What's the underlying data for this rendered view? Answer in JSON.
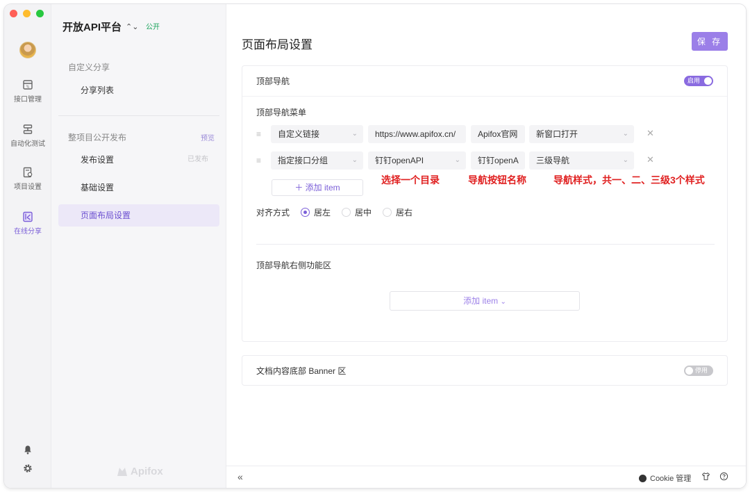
{
  "window": {
    "colors": {
      "close": "#ff5f57",
      "minimize": "#febc2e",
      "maximize": "#28c840"
    }
  },
  "rail": {
    "items": [
      {
        "label": "接口管理",
        "icon": "api-icon"
      },
      {
        "label": "自动化测试",
        "icon": "automation-icon"
      },
      {
        "label": "项目设置",
        "icon": "settings-doc-icon"
      },
      {
        "label": "在线分享",
        "icon": "share-icon",
        "active": true
      }
    ],
    "bottom_icons": [
      "bell-icon",
      "gear-icon"
    ]
  },
  "sidebar": {
    "project_name": "开放API平台",
    "project_badge": "公开",
    "section1": "自定义分享",
    "item_share_list": "分享列表",
    "section2": "整项目公开发布",
    "section2_tag": "预览",
    "item_publish": "发布设置",
    "item_publish_tag": "已发布",
    "item_basic": "基础设置",
    "item_layout": "页面布局设置",
    "brand": "Apifox"
  },
  "main": {
    "title": "页面布局设置",
    "save": "保 存",
    "top_nav": {
      "label": "顶部导航",
      "toggle": "启用",
      "menu_label": "顶部导航菜单",
      "rows": [
        {
          "type": "自定义链接",
          "target": "https://www.apifox.cn/",
          "name": "Apifox官网",
          "style": "新窗口打开"
        },
        {
          "type": "指定接口分组",
          "target": "钉钉openAPI",
          "name": "钉钉openA",
          "style": "三级导航"
        }
      ],
      "add_item": "添加 item",
      "align_label": "对齐方式",
      "align_options": [
        "居左",
        "居中",
        "居右"
      ],
      "align_selected": "居左",
      "right_area_label": "顶部导航右侧功能区",
      "right_add_item": "添加 item"
    },
    "annotations": [
      "选择一个目录",
      "导航按钮名称",
      "导航样式，共一、二、三级3个样式"
    ],
    "banner": {
      "label": "文档内容底部 Banner 区",
      "toggle": "停用"
    }
  },
  "footer": {
    "cookie": "Cookie 管理"
  },
  "colors": {
    "accent": "#9b7fe8",
    "annotation": "#e02020",
    "public_badge": "#19a35a"
  }
}
